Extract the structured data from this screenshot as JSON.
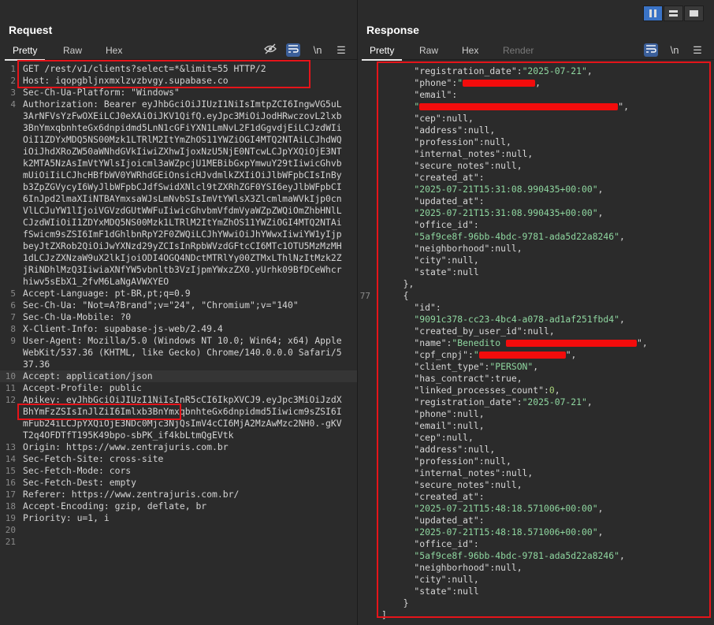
{
  "request": {
    "title": "Request",
    "tabs": [
      {
        "label": "Pretty",
        "active": true
      },
      {
        "label": "Raw",
        "active": false
      },
      {
        "label": "Hex",
        "active": false
      }
    ],
    "toolbar_icons": [
      "eye-slash-icon",
      "wrap-lines-icon",
      "newline-icon",
      "menu-icon"
    ],
    "newline_label": "\\n",
    "lines": [
      {
        "n": "1",
        "text": "GET /rest/v1/clients?select=*&limit=55 HTTP/2"
      },
      {
        "n": "2",
        "text": "Host: iqopgbljnxmxlzvzbvgy.supabase.co"
      },
      {
        "n": "3",
        "text": "Sec-Ch-Ua-Platform: \"Windows\""
      },
      {
        "n": "4",
        "text": "Authorization: Bearer eyJhbGciOiJIUzI1NiIsImtpZCI6IngwVG5uL3ArNFVsYzFwOXEiLCJ0eXAiOiJKV1QifQ.eyJpc3MiOiJodHRwczovL2lxb3BnYmxqbnhteGx6dnpidmd5LnN1cGFiYXN1LmNvL2F1dGgvdjEiLCJzdWIiOiI1ZDYxMDQ5NS00Mzk1LTRlM2ItYmZhOS11YWZiOGI4MTQ2NTAiLCJhdWQiOiJhdXRoZW50aWNhdGVkIiwiZXhwIjoxNzU5NjE0NTcwLCJpYXQiOjE3NTk2MTA5NzAsImVtYWlsIjoicml3aWZpcjU1MEBibGxpYmwuY29tIiwicGhvbmUiOiIiLCJhcHBfbWV0YWRhdGEiOnsicHJvdmlkZXIiOiJlbWFpbCIsInByb3ZpZGVycyI6WyJlbWFpbCJdfSwidXNlcl9tZXRhZGF0YSI6eyJlbWFpbCI6InJpd2lmaXIiNTBAYmxsaWJsLmNvbSIsImVtYWlsX3ZlcmlmaWVkIjp0cnVlLCJuYW1lIjoiVGVzdGUtWWFuIiwicGhvbmVfdmVyaWZpZWQiOmZhbHNlLCJzdWIiOiI1ZDYxMDQ5NS00Mzk1LTRlM2ItYmZhOS11YWZiOGI4MTQ2NTAifSwicm9sZSI6ImF1dGhlbnRpY2F0ZWQiLCJhYWwiOiJhYWwxIiwiYW1yIjpbeyJtZXRob2QiOiJwYXNzd29yZCIsInRpbWVzdGFtcCI6MTc1OTU5MzMzMH1dLCJzZXNzaW9uX2lkIjoiODI4OGQ4NDctMTRlYy00ZTMxLThlNzItMzk2ZjRiNDhlMzQ3IiwiaXNfYW5vbnltb3VzIjpmYWxzZX0.yUrhk09BfDCeWhcrhiwv5sEbX1_2fvM6LaNgAVWXYEO"
      },
      {
        "n": "5",
        "text": "Accept-Language: pt-BR,pt;q=0.9"
      },
      {
        "n": "6",
        "text": "Sec-Ch-Ua: \"Not=A?Brand\";v=\"24\", \"Chromium\";v=\"140\""
      },
      {
        "n": "7",
        "text": "Sec-Ch-Ua-Mobile: ?0"
      },
      {
        "n": "8",
        "text": "X-Client-Info: supabase-js-web/2.49.4"
      },
      {
        "n": "9",
        "text": "User-Agent: Mozilla/5.0 (Windows NT 10.0; Win64; x64) AppleWebKit/537.36 (KHTML, like Gecko) Chrome/140.0.0.0 Safari/537.36"
      },
      {
        "n": "10",
        "text": "Accept: application/json"
      },
      {
        "n": "11",
        "text": "Accept-Profile: public"
      },
      {
        "n": "12",
        "text": "Apikey: eyJhbGciOiJIUzI1NiIsInR5cCI6IkpXVCJ9.eyJpc3MiOiJzdXBhYmFzZSIsInJlZiI6Imlxb3BnYmxqbnhteGx6dnpidmd5Iiwicm9sZSI6ImFub24iLCJpYXQiOjE3NDc0Mjc3NjQsImV4cCI6MjA2MzAwMzc2NH0.-gKVT2q4OFDTfT195K49bpo-sbPK_if4kbLtmQgEVtk"
      },
      {
        "n": "13",
        "text": "Origin: https://www.zentrajuris.com.br"
      },
      {
        "n": "14",
        "text": "Sec-Fetch-Site: cross-site"
      },
      {
        "n": "15",
        "text": "Sec-Fetch-Mode: cors"
      },
      {
        "n": "16",
        "text": "Sec-Fetch-Dest: empty"
      },
      {
        "n": "17",
        "text": "Referer: https://www.zentrajuris.com.br/"
      },
      {
        "n": "18",
        "text": "Accept-Encoding: gzip, deflate, br"
      },
      {
        "n": "19",
        "text": "Priority: u=1, i"
      },
      {
        "n": "20",
        "text": ""
      },
      {
        "n": "21",
        "text": ""
      }
    ]
  },
  "response": {
    "title": "Response",
    "tabs": [
      {
        "label": "Pretty",
        "active": true
      },
      {
        "label": "Raw",
        "active": false
      },
      {
        "label": "Hex",
        "active": false
      },
      {
        "label": "Render",
        "active": false
      }
    ],
    "toolbar_icons": [
      "wrap-lines-icon",
      "newline-icon",
      "menu-icon"
    ],
    "newline_label": "\\n",
    "view_mode_icons": [
      "split-horizontal-icon",
      "split-vertical-icon",
      "single-pane-icon"
    ],
    "lines": [
      {
        "n": "",
        "indent": 6,
        "parts": [
          {
            "t": "k",
            "v": "\"registration_date\""
          },
          {
            "t": "p",
            "v": ":"
          },
          {
            "t": "s",
            "v": "\"2025-07-21\""
          },
          {
            "t": "p",
            "v": ","
          }
        ]
      },
      {
        "n": "",
        "indent": 6,
        "parts": [
          {
            "t": "k",
            "v": "\"phone\""
          },
          {
            "t": "p",
            "v": ":"
          },
          {
            "t": "s",
            "v": "\""
          },
          {
            "t": "redact",
            "w": 92
          },
          {
            "t": "p",
            "v": ","
          }
        ]
      },
      {
        "n": "",
        "indent": 6,
        "parts": [
          {
            "t": "k",
            "v": "\"email\""
          },
          {
            "t": "p",
            "v": ":"
          }
        ]
      },
      {
        "n": "",
        "indent": 6,
        "parts": [
          {
            "t": "s",
            "v": "\""
          },
          {
            "t": "redact",
            "w": 252
          },
          {
            "t": "p",
            "v": "\","
          }
        ]
      },
      {
        "n": "",
        "indent": 6,
        "parts": [
          {
            "t": "k",
            "v": "\"cep\""
          },
          {
            "t": "p",
            "v": ":"
          },
          {
            "t": "n",
            "v": "null"
          },
          {
            "t": "p",
            "v": ","
          }
        ]
      },
      {
        "n": "",
        "indent": 6,
        "parts": [
          {
            "t": "k",
            "v": "\"address\""
          },
          {
            "t": "p",
            "v": ":"
          },
          {
            "t": "n",
            "v": "null"
          },
          {
            "t": "p",
            "v": ","
          }
        ]
      },
      {
        "n": "",
        "indent": 6,
        "parts": [
          {
            "t": "k",
            "v": "\"profession\""
          },
          {
            "t": "p",
            "v": ":"
          },
          {
            "t": "n",
            "v": "null"
          },
          {
            "t": "p",
            "v": ","
          }
        ]
      },
      {
        "n": "",
        "indent": 6,
        "parts": [
          {
            "t": "k",
            "v": "\"internal_notes\""
          },
          {
            "t": "p",
            "v": ":"
          },
          {
            "t": "n",
            "v": "null"
          },
          {
            "t": "p",
            "v": ","
          }
        ]
      },
      {
        "n": "",
        "indent": 6,
        "parts": [
          {
            "t": "k",
            "v": "\"secure_notes\""
          },
          {
            "t": "p",
            "v": ":"
          },
          {
            "t": "n",
            "v": "null"
          },
          {
            "t": "p",
            "v": ","
          }
        ]
      },
      {
        "n": "",
        "indent": 6,
        "parts": [
          {
            "t": "k",
            "v": "\"created_at\""
          },
          {
            "t": "p",
            "v": ":"
          }
        ]
      },
      {
        "n": "",
        "indent": 6,
        "parts": [
          {
            "t": "s",
            "v": "\"2025-07-21T15:31:08.990435+00:00\""
          },
          {
            "t": "p",
            "v": ","
          }
        ]
      },
      {
        "n": "",
        "indent": 6,
        "parts": [
          {
            "t": "k",
            "v": "\"updated_at\""
          },
          {
            "t": "p",
            "v": ":"
          }
        ]
      },
      {
        "n": "",
        "indent": 6,
        "parts": [
          {
            "t": "s",
            "v": "\"2025-07-21T15:31:08.990435+00:00\""
          },
          {
            "t": "p",
            "v": ","
          }
        ]
      },
      {
        "n": "",
        "indent": 6,
        "parts": [
          {
            "t": "k",
            "v": "\"office_id\""
          },
          {
            "t": "p",
            "v": ":"
          }
        ]
      },
      {
        "n": "",
        "indent": 6,
        "parts": [
          {
            "t": "s",
            "v": "\"5af9ce8f-96bb-4bdc-9781-ada5d22a8246\""
          },
          {
            "t": "p",
            "v": ","
          }
        ]
      },
      {
        "n": "",
        "indent": 6,
        "parts": [
          {
            "t": "k",
            "v": "\"neighborhood\""
          },
          {
            "t": "p",
            "v": ":"
          },
          {
            "t": "n",
            "v": "null"
          },
          {
            "t": "p",
            "v": ","
          }
        ]
      },
      {
        "n": "",
        "indent": 6,
        "parts": [
          {
            "t": "k",
            "v": "\"city\""
          },
          {
            "t": "p",
            "v": ":"
          },
          {
            "t": "n",
            "v": "null"
          },
          {
            "t": "p",
            "v": ","
          }
        ]
      },
      {
        "n": "",
        "indent": 6,
        "parts": [
          {
            "t": "k",
            "v": "\"state\""
          },
          {
            "t": "p",
            "v": ":"
          },
          {
            "t": "n",
            "v": "null"
          }
        ]
      },
      {
        "n": "",
        "indent": 4,
        "parts": [
          {
            "t": "p",
            "v": "},"
          }
        ]
      },
      {
        "n": "77",
        "indent": 4,
        "parts": [
          {
            "t": "p",
            "v": "{"
          }
        ]
      },
      {
        "n": "",
        "indent": 6,
        "parts": [
          {
            "t": "k",
            "v": "\"id\""
          },
          {
            "t": "p",
            "v": ":"
          }
        ]
      },
      {
        "n": "",
        "indent": 6,
        "parts": [
          {
            "t": "s",
            "v": "\"9091c378-cc23-4bc4-a078-ad1af251fbd4\""
          },
          {
            "t": "p",
            "v": ","
          }
        ]
      },
      {
        "n": "",
        "indent": 6,
        "parts": [
          {
            "t": "k",
            "v": "\"created_by_user_id\""
          },
          {
            "t": "p",
            "v": ":"
          },
          {
            "t": "n",
            "v": "null"
          },
          {
            "t": "p",
            "v": ","
          }
        ]
      },
      {
        "n": "",
        "indent": 6,
        "parts": [
          {
            "t": "k",
            "v": "\"name\""
          },
          {
            "t": "p",
            "v": ":"
          },
          {
            "t": "s",
            "v": "\"Benedito "
          },
          {
            "t": "redact",
            "w": 166
          },
          {
            "t": "p",
            "v": "\","
          }
        ]
      },
      {
        "n": "",
        "indent": 6,
        "parts": [
          {
            "t": "k",
            "v": "\"cpf_cnpj\""
          },
          {
            "t": "p",
            "v": ":"
          },
          {
            "t": "s",
            "v": "\""
          },
          {
            "t": "redact",
            "w": 110
          },
          {
            "t": "p",
            "v": "\","
          }
        ]
      },
      {
        "n": "",
        "indent": 6,
        "parts": [
          {
            "t": "k",
            "v": "\"client_type\""
          },
          {
            "t": "p",
            "v": ":"
          },
          {
            "t": "s",
            "v": "\"PERSON\""
          },
          {
            "t": "p",
            "v": ","
          }
        ]
      },
      {
        "n": "",
        "indent": 6,
        "parts": [
          {
            "t": "k",
            "v": "\"has_contract\""
          },
          {
            "t": "p",
            "v": ":"
          },
          {
            "t": "n",
            "v": "true"
          },
          {
            "t": "p",
            "v": ","
          }
        ]
      },
      {
        "n": "",
        "indent": 6,
        "parts": [
          {
            "t": "k",
            "v": "\"linked_processes_count\""
          },
          {
            "t": "p",
            "v": ":"
          },
          {
            "t": "num",
            "v": "0"
          },
          {
            "t": "p",
            "v": ","
          }
        ]
      },
      {
        "n": "",
        "indent": 6,
        "parts": [
          {
            "t": "k",
            "v": "\"registration_date\""
          },
          {
            "t": "p",
            "v": ":"
          },
          {
            "t": "s",
            "v": "\"2025-07-21\""
          },
          {
            "t": "p",
            "v": ","
          }
        ]
      },
      {
        "n": "",
        "indent": 6,
        "parts": [
          {
            "t": "k",
            "v": "\"phone\""
          },
          {
            "t": "p",
            "v": ":"
          },
          {
            "t": "n",
            "v": "null"
          },
          {
            "t": "p",
            "v": ","
          }
        ]
      },
      {
        "n": "",
        "indent": 6,
        "parts": [
          {
            "t": "k",
            "v": "\"email\""
          },
          {
            "t": "p",
            "v": ":"
          },
          {
            "t": "n",
            "v": "null"
          },
          {
            "t": "p",
            "v": ","
          }
        ]
      },
      {
        "n": "",
        "indent": 6,
        "parts": [
          {
            "t": "k",
            "v": "\"cep\""
          },
          {
            "t": "p",
            "v": ":"
          },
          {
            "t": "n",
            "v": "null"
          },
          {
            "t": "p",
            "v": ","
          }
        ]
      },
      {
        "n": "",
        "indent": 6,
        "parts": [
          {
            "t": "k",
            "v": "\"address\""
          },
          {
            "t": "p",
            "v": ":"
          },
          {
            "t": "n",
            "v": "null"
          },
          {
            "t": "p",
            "v": ","
          }
        ]
      },
      {
        "n": "",
        "indent": 6,
        "parts": [
          {
            "t": "k",
            "v": "\"profession\""
          },
          {
            "t": "p",
            "v": ":"
          },
          {
            "t": "n",
            "v": "null"
          },
          {
            "t": "p",
            "v": ","
          }
        ]
      },
      {
        "n": "",
        "indent": 6,
        "parts": [
          {
            "t": "k",
            "v": "\"internal_notes\""
          },
          {
            "t": "p",
            "v": ":"
          },
          {
            "t": "n",
            "v": "null"
          },
          {
            "t": "p",
            "v": ","
          }
        ]
      },
      {
        "n": "",
        "indent": 6,
        "parts": [
          {
            "t": "k",
            "v": "\"secure_notes\""
          },
          {
            "t": "p",
            "v": ":"
          },
          {
            "t": "n",
            "v": "null"
          },
          {
            "t": "p",
            "v": ","
          }
        ]
      },
      {
        "n": "",
        "indent": 6,
        "parts": [
          {
            "t": "k",
            "v": "\"created_at\""
          },
          {
            "t": "p",
            "v": ":"
          }
        ]
      },
      {
        "n": "",
        "indent": 6,
        "parts": [
          {
            "t": "s",
            "v": "\"2025-07-21T15:48:18.571006+00:00\""
          },
          {
            "t": "p",
            "v": ","
          }
        ]
      },
      {
        "n": "",
        "indent": 6,
        "parts": [
          {
            "t": "k",
            "v": "\"updated_at\""
          },
          {
            "t": "p",
            "v": ":"
          }
        ]
      },
      {
        "n": "",
        "indent": 6,
        "parts": [
          {
            "t": "s",
            "v": "\"2025-07-21T15:48:18.571006+00:00\""
          },
          {
            "t": "p",
            "v": ","
          }
        ]
      },
      {
        "n": "",
        "indent": 6,
        "parts": [
          {
            "t": "k",
            "v": "\"office_id\""
          },
          {
            "t": "p",
            "v": ":"
          }
        ]
      },
      {
        "n": "",
        "indent": 6,
        "parts": [
          {
            "t": "s",
            "v": "\"5af9ce8f-96bb-4bdc-9781-ada5d22a8246\""
          },
          {
            "t": "p",
            "v": ","
          }
        ]
      },
      {
        "n": "",
        "indent": 6,
        "parts": [
          {
            "t": "k",
            "v": "\"neighborhood\""
          },
          {
            "t": "p",
            "v": ":"
          },
          {
            "t": "n",
            "v": "null"
          },
          {
            "t": "p",
            "v": ","
          }
        ]
      },
      {
        "n": "",
        "indent": 6,
        "parts": [
          {
            "t": "k",
            "v": "\"city\""
          },
          {
            "t": "p",
            "v": ":"
          },
          {
            "t": "n",
            "v": "null"
          },
          {
            "t": "p",
            "v": ","
          }
        ]
      },
      {
        "n": "",
        "indent": 6,
        "parts": [
          {
            "t": "k",
            "v": "\"state\""
          },
          {
            "t": "p",
            "v": ":"
          },
          {
            "t": "n",
            "v": "null"
          }
        ]
      },
      {
        "n": "",
        "indent": 4,
        "parts": [
          {
            "t": "p",
            "v": "}"
          }
        ]
      },
      {
        "n": "",
        "indent": 0,
        "parts": [
          {
            "t": "p",
            "v": "]"
          }
        ]
      }
    ]
  },
  "colors": {
    "highlight_box": "#e5141a",
    "redaction": "#f20c0c",
    "string_value": "#8fd7a0",
    "number_value": "#a8d27a",
    "active_toggle": "#3b5f9a"
  }
}
